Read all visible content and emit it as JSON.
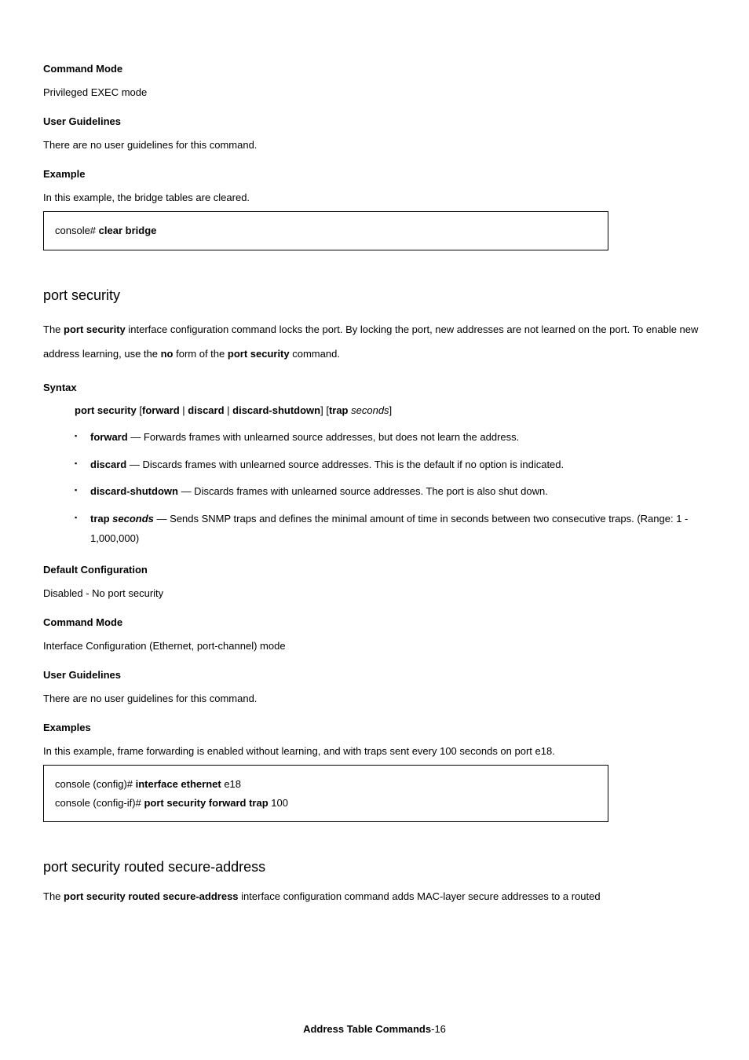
{
  "sec1": {
    "command_mode_h": "Command Mode",
    "command_mode_t": "Privileged EXEC mode",
    "user_guidelines_h": "User Guidelines",
    "user_guidelines_t": "There are no user guidelines for this command.",
    "example_h": "Example",
    "example_intro": "In this example, the bridge tables are cleared.",
    "example_prompt": "console#",
    "example_cmd": "clear bridge"
  },
  "ps": {
    "title": "port security",
    "para_a": "The ",
    "para_b": "port security",
    "para_c": " interface configuration command locks the port. By locking the port, new addresses are not learned on the port. To enable new address learning, use the ",
    "para_d": "no",
    "para_e": " form of the ",
    "para_f": "port security",
    "para_g": " command.",
    "syntax_h": "Syntax",
    "syn": {
      "cmd": "port security",
      "o1": "forward",
      "o2": "discard",
      "o3": "discard-shutdown",
      "o4": "trap",
      "o4arg": "seconds"
    },
    "opts": [
      {
        "k": "forward",
        "t": " — Forwards frames with unlearned source addresses, but does not learn the address."
      },
      {
        "k": "discard",
        "t": " — Discards frames with unlearned source addresses. This is the default if no option is indicated."
      },
      {
        "k": "discard-shutdown",
        "t": " — Discards frames with unlearned source addresses. The port is also shut down."
      },
      {
        "k": "trap ",
        "kit": "seconds",
        "t": " — Sends SNMP traps and defines the minimal amount of time in seconds between two consecutive traps. (Range: 1 - 1,000,000)"
      }
    ],
    "default_h": "Default Configuration",
    "default_t": "Disabled - No port security",
    "command_mode_h": "Command Mode",
    "command_mode_t": "Interface Configuration (Ethernet, port-channel) mode",
    "user_guidelines_h": "User Guidelines",
    "user_guidelines_t": "There are no user guidelines for this command.",
    "example_h": "Examples",
    "example_intro": "In this example, frame forwarding is enabled without learning, and with traps sent every 100 seconds on port e18.",
    "ex": {
      "l1p": "console (config)# ",
      "l1c": "interface ethernet",
      "l1a": " e18",
      "l2p": "console (config-if)# ",
      "l2c": "port security forward trap",
      "l2a": " 100"
    }
  },
  "psr": {
    "title": "port security routed secure-address",
    "para_a": "The ",
    "para_b": "port security routed secure-address",
    "para_c": " interface configuration command adds MAC-layer secure addresses to a routed"
  },
  "footer": {
    "chapter": "Address Table Commands",
    "page": "-16"
  }
}
